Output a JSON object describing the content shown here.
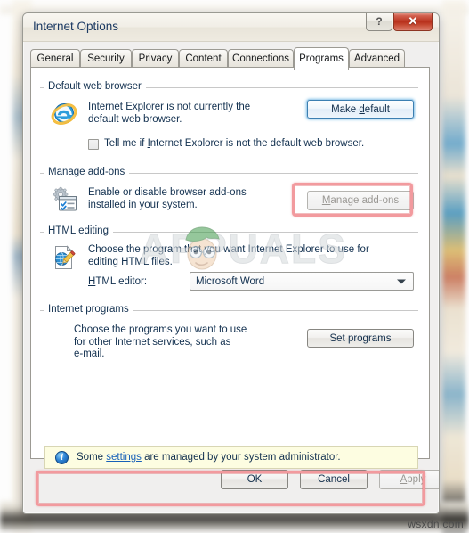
{
  "window": {
    "title": "Internet Options",
    "help_button": "?",
    "close_button": "✕"
  },
  "tabs": [
    {
      "label": "General",
      "active": false
    },
    {
      "label": "Security",
      "active": false
    },
    {
      "label": "Privacy",
      "active": false
    },
    {
      "label": "Content",
      "active": false
    },
    {
      "label": "Connections",
      "active": false
    },
    {
      "label": "Programs",
      "active": true
    },
    {
      "label": "Advanced",
      "active": false
    }
  ],
  "groups": {
    "default_browser": {
      "title": "Default web browser",
      "icon": "internet-explorer-icon",
      "line1": "Internet Explorer is not currently the",
      "line2": "default web browser.",
      "button": "Make default",
      "button_accesskey": "d",
      "checkbox_label_pre": "Tell me if ",
      "checkbox_label_key": "I",
      "checkbox_label_post": "nternet Explorer is not the default web browser.",
      "checkbox_checked": false
    },
    "manage_addons": {
      "title": "Manage add-ons",
      "icon": "addons-gear-icon",
      "line1": "Enable or disable browser add-ons",
      "line2": "installed in your system.",
      "button_pre": "M",
      "button_post": "anage add-ons",
      "button_disabled": true
    },
    "html_editing": {
      "title": "HTML editing",
      "icon": "html-editor-icon",
      "line1": "Choose the program that you want Internet Explorer to use for",
      "line2": "editing HTML files.",
      "field_label_key": "H",
      "field_label_rest": "TML editor:",
      "combo_value": "Microsoft Word"
    },
    "internet_programs": {
      "title": "Internet programs",
      "line1": "Choose the programs you want to use",
      "line2": "for other Internet services, such as",
      "line3": "e-mail.",
      "button": "Set programs"
    }
  },
  "infobar": {
    "icon": "info-icon",
    "text_pre": "Some ",
    "link": "settings",
    "text_post": " are managed by your system administrator."
  },
  "footer": {
    "ok": "OK",
    "cancel": "Cancel",
    "apply": "Apply",
    "apply_disabled": true
  },
  "watermarks": {
    "overlay": "APPUALS",
    "corner": "wsxdn.com"
  },
  "colors": {
    "annotation": "#f29a9e",
    "title_text": "#1c3a63",
    "link": "#1760b8",
    "close_button": "#b8311c",
    "infobar_bg": "#fdfde1"
  }
}
